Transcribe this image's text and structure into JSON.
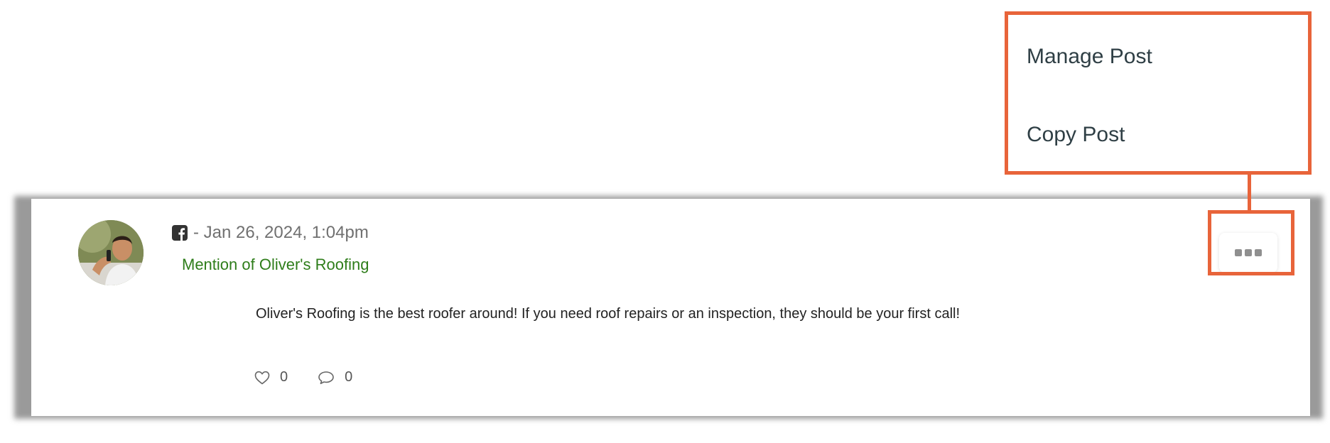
{
  "menu": {
    "items": [
      {
        "label": "Manage Post"
      },
      {
        "label": "Copy Post"
      }
    ]
  },
  "post": {
    "network_icon": "facebook-icon",
    "timestamp": "- Jan 26, 2024, 1:04pm",
    "mention": "Mention of Oliver's Roofing",
    "text": "Oliver's Roofing is the best roofer around! If you need roof repairs or an inspection, they should be your first call!",
    "likes": "0",
    "comments": "0"
  },
  "colors": {
    "highlight": "#e8643a",
    "mention": "#2e7d1a",
    "menu_text": "#2f3f45"
  }
}
